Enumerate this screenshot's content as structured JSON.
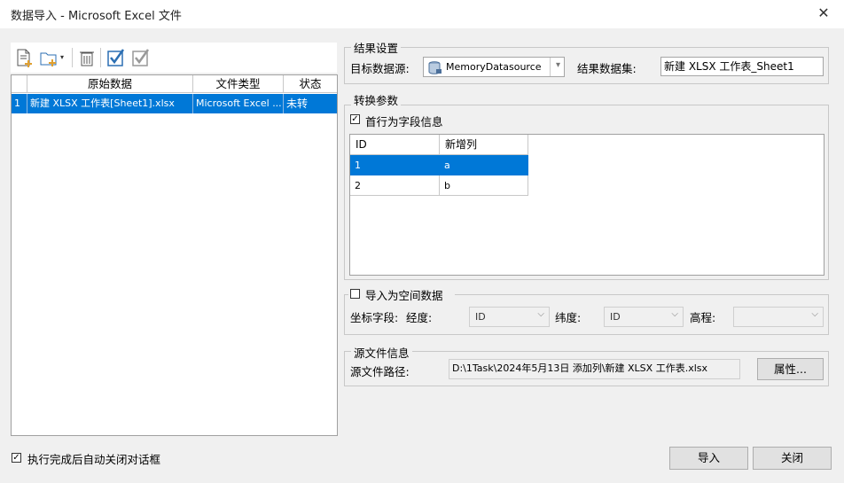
{
  "window": {
    "title": "数据导入 - Microsoft Excel 文件",
    "close": "✕"
  },
  "toolbar": {
    "icons": [
      "add-file-icon",
      "add-folder-icon",
      "delete-icon",
      "select-all-icon",
      "select-invert-icon"
    ]
  },
  "file_list": {
    "columns": [
      "原始数据",
      "文件类型",
      "状态"
    ],
    "rows": [
      {
        "index": "1",
        "source": "新建 XLSX 工作表[Sheet1].xlsx",
        "type": "Microsoft Excel ...",
        "status": "未转"
      }
    ]
  },
  "result_settings": {
    "group_label": "结果设置",
    "target_datasource_label": "目标数据源:",
    "target_datasource_value": "MemoryDatasource",
    "result_dataset_label": "结果数据集:",
    "result_dataset_value": "新建 XLSX 工作表_Sheet1"
  },
  "conversion": {
    "group_label": "转换参数",
    "first_row_checkbox": "首行为字段信息",
    "first_row_checked": true,
    "columns": [
      "ID",
      "新增列"
    ],
    "rows": [
      [
        "1",
        "a"
      ],
      [
        "2",
        "b"
      ]
    ]
  },
  "spatial": {
    "group_label": "导入为空间数据",
    "checked": false,
    "coord_field_label": "坐标字段:",
    "longitude_label": "经度:",
    "longitude_value": "ID",
    "latitude_label": "纬度:",
    "latitude_value": "ID",
    "elevation_label": "高程:",
    "elevation_value": ""
  },
  "source_info": {
    "group_label": "源文件信息",
    "path_label": "源文件路径:",
    "path_value": "D:\\1Task\\2024年5月13日 添加列\\新建 XLSX 工作表.xlsx",
    "properties_button": "属性..."
  },
  "footer": {
    "auto_close_label": "执行完成后自动关闭对话框",
    "auto_close_checked": true,
    "import_button": "导入",
    "close_button": "关闭"
  },
  "colors": {
    "selection": "#0078d7",
    "background": "#f0f0f0"
  }
}
